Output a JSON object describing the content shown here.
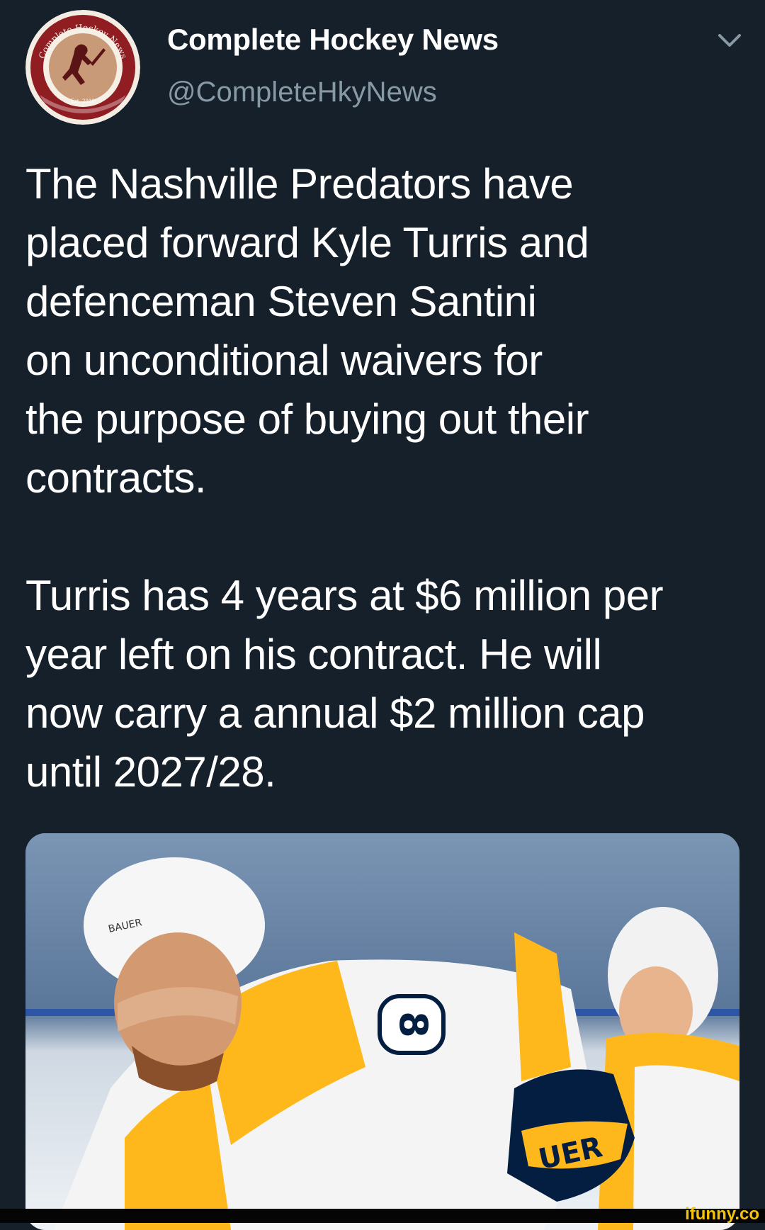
{
  "tweet": {
    "author": {
      "display_name": "Complete Hockey News",
      "handle": "@CompleteHkyNews",
      "avatar_logo_text": "Complete Hockey News",
      "avatar_logo_subtext": "Est. 2010"
    },
    "menu_icon": "chevron-down-icon",
    "text_paragraphs": [
      [
        "The Nashville Predators have",
        "placed forward Kyle Turris and",
        "defenceman Steven Santini",
        "on unconditional waivers for",
        "the purpose of buying out their",
        "contracts."
      ],
      [
        "Turris has 4 years at $6 million per",
        "year left on his contract. He will",
        "now carry a annual $2 million cap",
        "until 2027/28."
      ]
    ],
    "media": {
      "jersey_number": "8",
      "helmet_brand": "BAUER",
      "glove_brand": "UER"
    }
  },
  "watermark": "ifunny.co",
  "colors": {
    "background": "#15202b",
    "text": "#ffffff",
    "secondary_text": "#8899a6",
    "predators_gold": "#ffb81c",
    "predators_navy": "#041e42"
  }
}
